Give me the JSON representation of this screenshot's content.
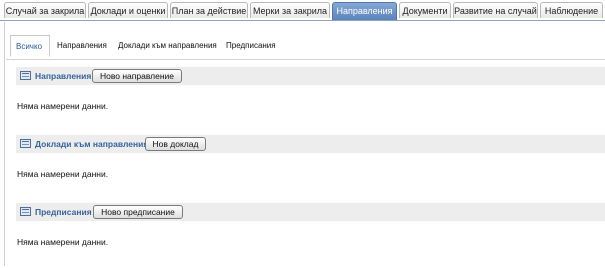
{
  "top_tabs": [
    {
      "label": "Случай за закрила"
    },
    {
      "label": "Доклади и оценки"
    },
    {
      "label": "План за действие"
    },
    {
      "label": "Мерки за закрила"
    },
    {
      "label": "Направления"
    },
    {
      "label": "Документи"
    },
    {
      "label": "Развитие на случай"
    },
    {
      "label": "Наблюдение"
    }
  ],
  "active_top_tab": "Направления",
  "sub_tabs": [
    {
      "label": "Всичко"
    },
    {
      "label": "Направления"
    },
    {
      "label": "Доклади към направления"
    },
    {
      "label": "Предписания"
    }
  ],
  "active_sub_tab": "Всичко",
  "sections": [
    {
      "icon": "list-icon",
      "title": "Направления",
      "button": "Ново направление",
      "empty_text": "Няма намерени данни."
    },
    {
      "icon": "list-icon",
      "title": "Доклади към направления",
      "button": "Нов доклад",
      "empty_text": "Няма намерени данни."
    },
    {
      "icon": "list-icon",
      "title": "Предписания",
      "button": "Ново предписание",
      "empty_text": "Няма намерени данни."
    }
  ],
  "colors": {
    "active_tab": "#5b84bb",
    "section_title": "#34649c",
    "section_header_bg": "#ededed"
  }
}
